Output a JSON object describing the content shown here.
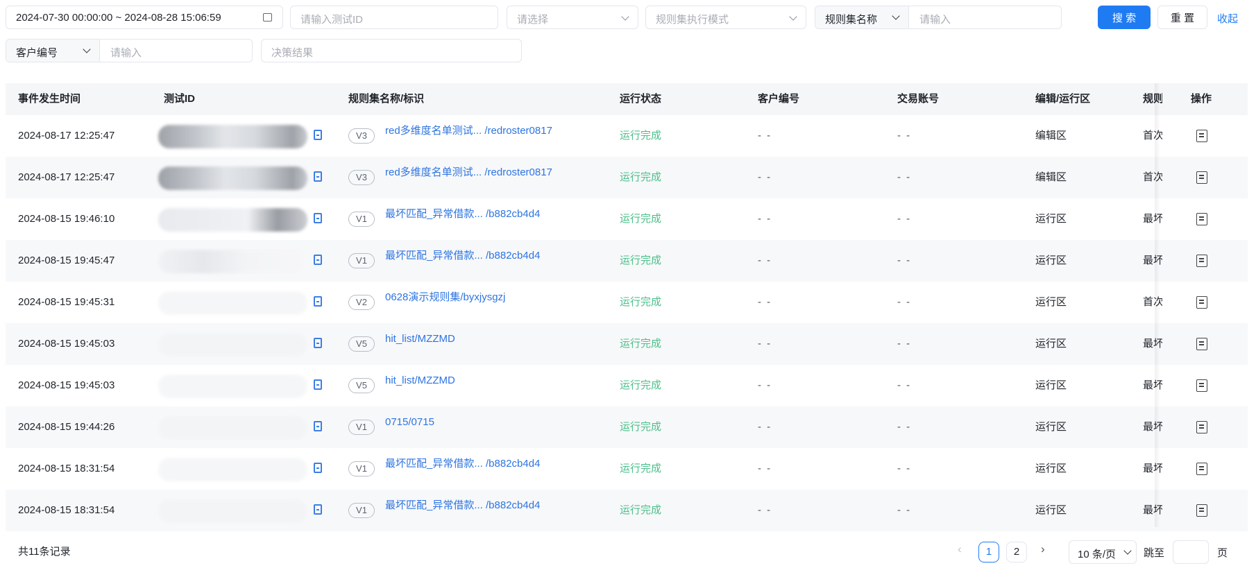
{
  "filters": {
    "date_range": "2024-07-30 00:00:00 ~ 2024-08-28 15:06:59",
    "test_id_placeholder": "请输入测试ID",
    "select_placeholder": "请选择",
    "exec_mode_placeholder": "规则集执行模式",
    "ruleset_field_label": "规则集名称",
    "ruleset_input_placeholder": "请输入",
    "search_label": "搜 索",
    "reset_label": "重 置",
    "collapse_label": "收起",
    "customer_field_label": "客户编号",
    "customer_input_placeholder": "请输入",
    "decision_placeholder": "决策结果"
  },
  "table": {
    "headers": {
      "time": "事件发生时间",
      "test_id": "测试ID",
      "ruleset": "规则集名称/标识",
      "status": "运行状态",
      "customer": "客户编号",
      "account": "交易账号",
      "zone": "编辑/运行区",
      "rule_type": "规则",
      "action": "操作"
    },
    "rows": [
      {
        "time": "2024-08-17 12:25:47",
        "version": "V3",
        "ruleset": "red多维度名单测试... /redroster0817",
        "status": "运行完成",
        "customer": "- -",
        "account": "- -",
        "zone": "编辑区",
        "rule_type": "首次"
      },
      {
        "time": "2024-08-17 12:25:47",
        "version": "V3",
        "ruleset": "red多维度名单测试... /redroster0817",
        "status": "运行完成",
        "customer": "- -",
        "account": "- -",
        "zone": "编辑区",
        "rule_type": "首次"
      },
      {
        "time": "2024-08-15 19:46:10",
        "version": "V1",
        "ruleset": "最坏匹配_异常借款... /b882cb4d4",
        "status": "运行完成",
        "customer": "- -",
        "account": "- -",
        "zone": "运行区",
        "rule_type": "最坏"
      },
      {
        "time": "2024-08-15 19:45:47",
        "version": "V1",
        "ruleset": "最坏匹配_异常借款... /b882cb4d4",
        "status": "运行完成",
        "customer": "- -",
        "account": "- -",
        "zone": "运行区",
        "rule_type": "最坏"
      },
      {
        "time": "2024-08-15 19:45:31",
        "version": "V2",
        "ruleset": "0628演示规则集/byxjysgzj",
        "status": "运行完成",
        "customer": "- -",
        "account": "- -",
        "zone": "运行区",
        "rule_type": "首次"
      },
      {
        "time": "2024-08-15 19:45:03",
        "version": "V5",
        "ruleset": "hit_list/MZZMD",
        "status": "运行完成",
        "customer": "- -",
        "account": "- -",
        "zone": "运行区",
        "rule_type": "最坏"
      },
      {
        "time": "2024-08-15 19:45:03",
        "version": "V5",
        "ruleset": "hit_list/MZZMD",
        "status": "运行完成",
        "customer": "- -",
        "account": "- -",
        "zone": "运行区",
        "rule_type": "最坏"
      },
      {
        "time": "2024-08-15 19:44:26",
        "version": "V1",
        "ruleset": "0715/0715",
        "status": "运行完成",
        "customer": "- -",
        "account": "- -",
        "zone": "运行区",
        "rule_type": "最坏"
      },
      {
        "time": "2024-08-15 18:31:54",
        "version": "V1",
        "ruleset": "最坏匹配_异常借款... /b882cb4d4",
        "status": "运行完成",
        "customer": "- -",
        "account": "- -",
        "zone": "运行区",
        "rule_type": "最坏"
      },
      {
        "time": "2024-08-15 18:31:54",
        "version": "V1",
        "ruleset": "最坏匹配_异常借款... /b882cb4d4",
        "status": "运行完成",
        "customer": "- -",
        "account": "- -",
        "zone": "运行区",
        "rule_type": "最坏"
      }
    ]
  },
  "footer": {
    "total": "共11条记录",
    "pages": [
      "1",
      "2"
    ],
    "current_page": "1",
    "page_size": "10 条/页",
    "jump_label": "跳至",
    "page_suffix": "页",
    "prev_icon": "chevron-left-icon",
    "next_icon": "chevron-right-icon"
  },
  "colors": {
    "primary": "#1f7bf2",
    "link": "#2d74e0",
    "success": "#4bc08a"
  }
}
